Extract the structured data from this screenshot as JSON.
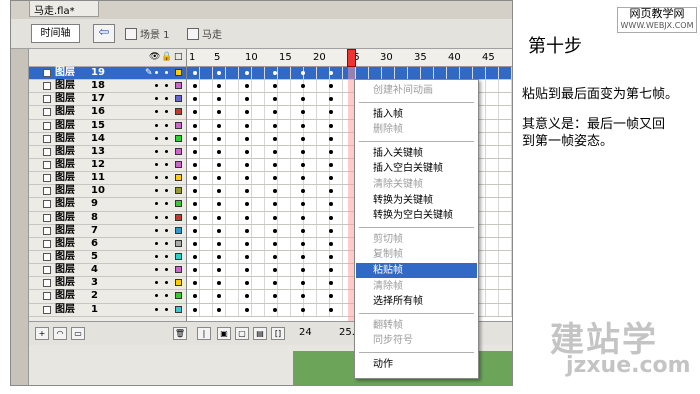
{
  "doc_tab": "马走.fla*",
  "toolbar": {
    "timeline_label": "时间轴",
    "back_glyph": "⇦",
    "scene": "场景 1",
    "symbol": "马走"
  },
  "layer_header": {
    "eye": "👁",
    "lock": "🔒",
    "outline": "□"
  },
  "layers": [
    {
      "name": "图层",
      "num": "19",
      "color": "#ffcc00",
      "selected": true
    },
    {
      "name": "图层",
      "num": "18",
      "color": "#cc66cc"
    },
    {
      "name": "图层",
      "num": "17",
      "color": "#6666cc"
    },
    {
      "name": "图层",
      "num": "16",
      "color": "#cc3333"
    },
    {
      "name": "图层",
      "num": "15",
      "color": "#cc66cc"
    },
    {
      "name": "图层",
      "num": "14",
      "color": "#33cc33"
    },
    {
      "name": "图层",
      "num": "13",
      "color": "#cc66cc"
    },
    {
      "name": "图层",
      "num": "12",
      "color": "#cc66cc"
    },
    {
      "name": "图层",
      "num": "11",
      "color": "#ffcc00"
    },
    {
      "name": "图层",
      "num": "10",
      "color": "#999933"
    },
    {
      "name": "图层",
      "num": "9",
      "color": "#33cc33"
    },
    {
      "name": "图层",
      "num": "8",
      "color": "#cc3333"
    },
    {
      "name": "图层",
      "num": "7",
      "color": "#3399cc"
    },
    {
      "name": "图层",
      "num": "6",
      "color": "#aaaaaa"
    },
    {
      "name": "图层",
      "num": "5",
      "color": "#33cccc"
    },
    {
      "name": "图层",
      "num": "4",
      "color": "#cc66cc"
    },
    {
      "name": "图层",
      "num": "3",
      "color": "#ffcc00"
    },
    {
      "name": "图层",
      "num": "2",
      "color": "#33cc33"
    },
    {
      "name": "图层",
      "num": "1",
      "color": "#33cccc"
    }
  ],
  "ruler": [
    "1",
    "5",
    "10",
    "15",
    "20",
    "25",
    "30",
    "35",
    "40",
    "45"
  ],
  "status": {
    "frame": "24",
    "fps": "25.0"
  },
  "context_menu": [
    {
      "label": "创建补间动画",
      "disabled": true
    },
    {
      "sep": true
    },
    {
      "label": "插入帧"
    },
    {
      "label": "删除帧",
      "disabled": true
    },
    {
      "sep": true
    },
    {
      "label": "插入关键帧"
    },
    {
      "label": "插入空白关键帧"
    },
    {
      "label": "清除关键帧",
      "disabled": true
    },
    {
      "label": "转换为关键帧"
    },
    {
      "label": "转换为空白关键帧"
    },
    {
      "sep": true
    },
    {
      "label": "剪切帧",
      "disabled": true
    },
    {
      "label": "复制帧",
      "disabled": true
    },
    {
      "label": "粘贴帧",
      "highlighted": true
    },
    {
      "label": "清除帧",
      "disabled": true
    },
    {
      "label": "选择所有帧"
    },
    {
      "sep": true
    },
    {
      "label": "翻转帧",
      "disabled": true
    },
    {
      "label": "同步符号",
      "disabled": true
    },
    {
      "sep": true
    },
    {
      "label": "动作"
    }
  ],
  "heading": "第十步",
  "text_lines": [
    "粘贴到最后面变为第七帧。",
    "其意义是：最后一帧又回",
    "到第一帧姿态。"
  ],
  "watermark": {
    "line1": "网页教学网",
    "line2": "WWW.WEBJX.COM"
  },
  "big_watermark": {
    "line1": "建站学",
    "line2": "jzxue.com"
  }
}
